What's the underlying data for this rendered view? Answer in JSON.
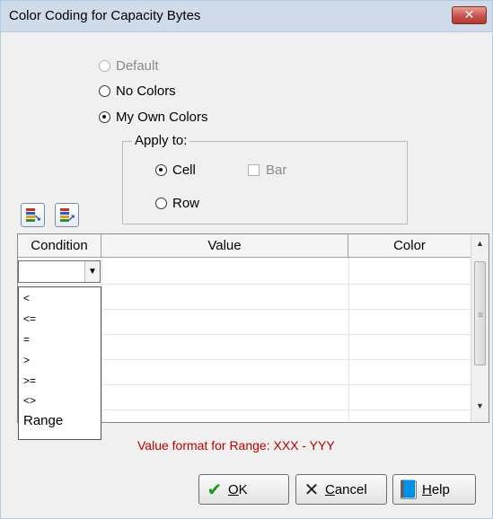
{
  "window": {
    "title": "Color Coding for Capacity Bytes",
    "close_label": "✕"
  },
  "options": {
    "default_label": "Default",
    "no_colors_label": "No Colors",
    "my_own_colors_label": "My Own Colors",
    "selected": "My Own Colors"
  },
  "apply_to": {
    "label": "Apply to:",
    "cell_label": "Cell",
    "bar_label": "Bar",
    "row_label": "Row",
    "selected": "Cell"
  },
  "grid": {
    "columns": [
      "Condition",
      "Value",
      "Color"
    ],
    "condition_value": "",
    "dropdown_options": [
      "<",
      "<=",
      "=",
      ">",
      ">=",
      "<>",
      "Range"
    ]
  },
  "hint": "Value format for Range: XXX - YYY",
  "buttons": {
    "ok_prefix": "",
    "ok_u": "O",
    "ok_rest": "K",
    "cancel_u": "C",
    "cancel_rest": "ancel",
    "help_u": "H",
    "help_rest": "elp"
  },
  "icons": {
    "close": "close-icon",
    "add_row": "insert-row-icon",
    "remove_row": "remove-row-icon",
    "ok": "checkmark-icon",
    "cancel": "x-icon",
    "help": "help-book-icon"
  },
  "colors": {
    "titlebar": "#cfdbe9",
    "close_button": "#c75050",
    "hint_text": "#c00000",
    "ok_check": "#1a9a1a",
    "cancel_x": "#222222"
  }
}
